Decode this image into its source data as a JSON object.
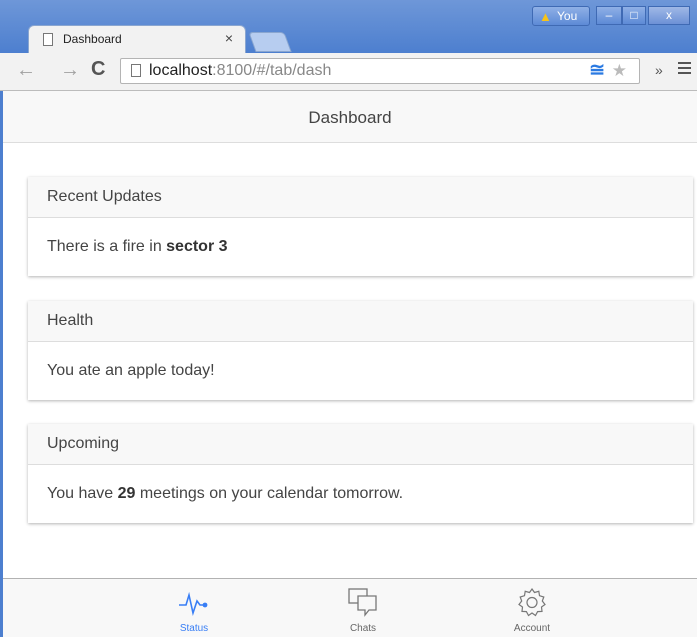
{
  "browser": {
    "tab_title": "Dashboard",
    "tab_close": "×",
    "user_label": "You",
    "warn_glyph": "▲",
    "window_buttons": {
      "minimize": "–",
      "maximize": "□",
      "close": "x"
    },
    "url_host": "localhost",
    "url_rest": ":8100/#/tab/dash",
    "nav": {
      "back": "←",
      "forward": "→",
      "reload": "C"
    },
    "bookmark_glyph": "★",
    "extension_glyph": "≅",
    "overflow_glyph": "»"
  },
  "app": {
    "header_title": "Dashboard",
    "cards": [
      {
        "title": "Recent Updates",
        "text_before": "There is a fire in ",
        "text_bold": "sector 3",
        "text_after": ""
      },
      {
        "title": "Health",
        "text_before": "You ate an apple today!",
        "text_bold": "",
        "text_after": ""
      },
      {
        "title": "Upcoming",
        "text_before": "You have ",
        "text_bold": "29",
        "text_after": " meetings on your calendar tomorrow."
      }
    ],
    "tabs": [
      {
        "label": "Status",
        "icon": "pulse-icon",
        "active": true
      },
      {
        "label": "Chats",
        "icon": "chat-bubbles-icon",
        "active": false
      },
      {
        "label": "Account",
        "icon": "gear-icon",
        "active": false
      }
    ]
  },
  "colors": {
    "accent": "#387ef5",
    "titlebar": "#4d7fcf",
    "header_bg": "#f8f8f8"
  }
}
